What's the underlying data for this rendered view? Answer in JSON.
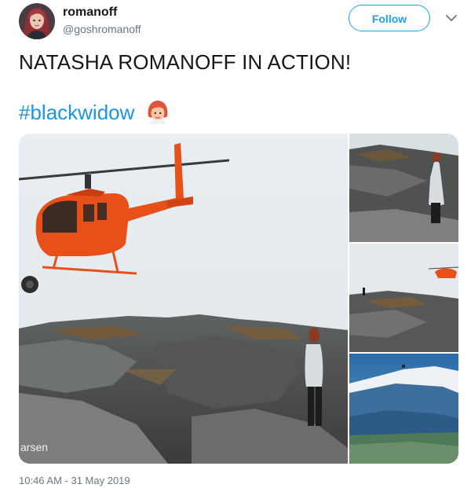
{
  "tweet": {
    "author_name": "romanoff",
    "author_handle": "@goshromanoff",
    "follow_label": "Follow",
    "text": "NATASHA ROMANOFF IN ACTION!",
    "hashtag": "#blackwidow",
    "timestamp": "10:46 AM - 31 May 2019"
  },
  "media": {
    "watermark": "arsen"
  },
  "icons": {
    "menu": "chevron-down-icon",
    "emoji": "redhead-woman-emoji"
  },
  "colors": {
    "accent": "#1da1f2",
    "link": "#1b95e0",
    "secondary_text": "#657786",
    "helicopter": "#e8501a"
  }
}
